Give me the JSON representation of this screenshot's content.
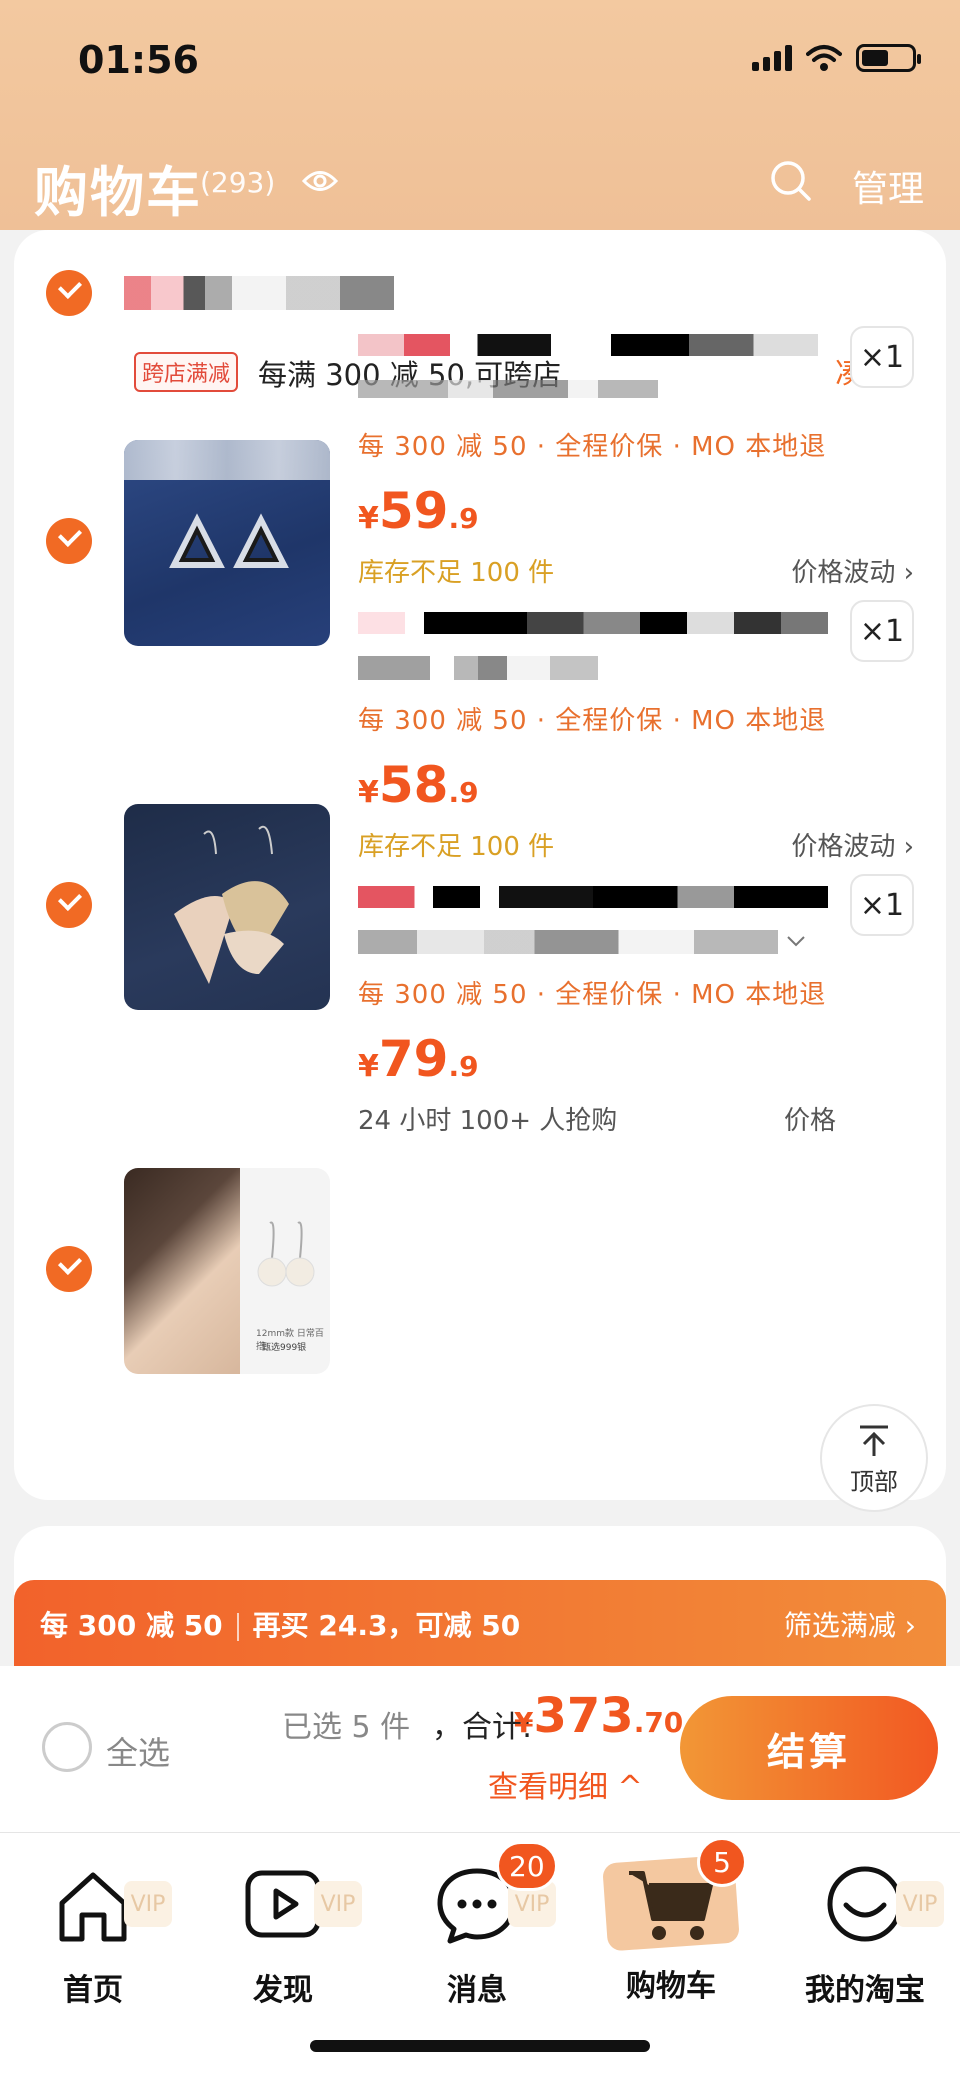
{
  "status_bar": {
    "time": "01:56"
  },
  "header": {
    "title": "购物车",
    "count": "(293)",
    "manage_label": "管理"
  },
  "shop": {
    "promo_tag": "跨店满减",
    "promo_text": "每满 300 减 50,可跨店",
    "coudan_label": "凑单 ›"
  },
  "items": [
    {
      "benefits": "每 300 减 50 · 全程价保 · MO 本地退",
      "price_symbol": "¥",
      "price_int": "59",
      "price_dec": ".9",
      "note": "库存不足 100 件",
      "fluct": "价格波动 ›",
      "qty": "×1"
    },
    {
      "benefits": "每 300 减 50 · 全程价保 · MO 本地退",
      "price_symbol": "¥",
      "price_int": "58",
      "price_dec": ".9",
      "note": "库存不足 100 件",
      "fluct": "价格波动 ›",
      "qty": "×1"
    },
    {
      "benefits": "每 300 减 50 · 全程价保 · MO 本地退",
      "price_symbol": "¥",
      "price_int": "79",
      "price_dec": ".9",
      "note": "24 小时 100+ 人抢购",
      "fluct": "价格",
      "qty": "×1"
    }
  ],
  "item3_caption": {
    "line1": "12mm款 日常百搭",
    "line2": "甄选999银"
  },
  "top_button": {
    "label": "顶部"
  },
  "promo_bar": {
    "left": "每 300 减 50",
    "middle": "再买 24.3，可减 50",
    "right": "筛选满减 ›"
  },
  "checkout": {
    "select_all": "全选",
    "selected": "已选 5 件",
    "total_label": "，合计:",
    "total_symbol": "¥",
    "total_int": "373",
    "total_dec": ".70",
    "detail": "查看明细 ^",
    "pay_label": "结算"
  },
  "tabs": [
    {
      "label": "首页",
      "vip": "VIP"
    },
    {
      "label": "发现",
      "vip": "VIP"
    },
    {
      "label": "消息",
      "vip": "VIP",
      "badge": "20"
    },
    {
      "label": "购物车",
      "badge": "5"
    },
    {
      "label": "我的淘宝",
      "vip": "VIP"
    }
  ],
  "colors": {
    "accent": "#f1561f",
    "header": "#f0c49b",
    "stock_note": "#d9a024"
  }
}
